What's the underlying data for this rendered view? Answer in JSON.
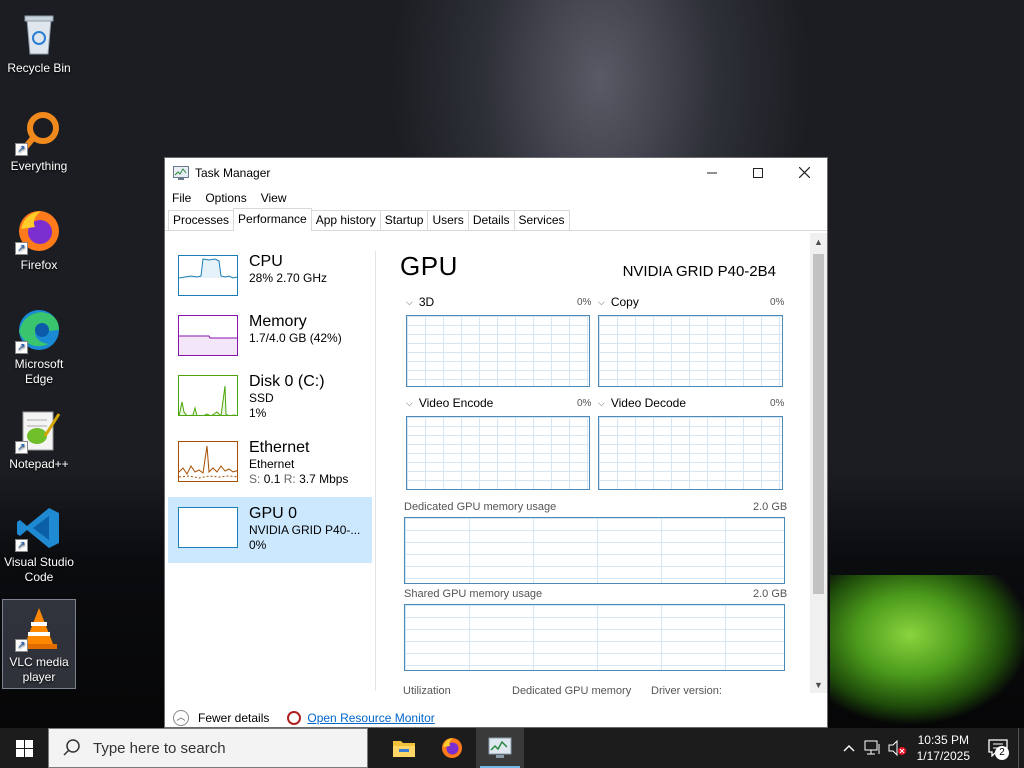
{
  "desktop": {
    "icons": [
      {
        "label": "Recycle Bin",
        "icon": "recycle-bin-icon"
      },
      {
        "label": "Everything",
        "icon": "search-magnifier-icon"
      },
      {
        "label": "Firefox",
        "icon": "firefox-icon"
      },
      {
        "label": "Microsoft Edge",
        "icon": "edge-icon"
      },
      {
        "label": "Notepad++",
        "icon": "notepadpp-icon"
      },
      {
        "label": "Visual Studio Code",
        "icon": "vscode-icon"
      },
      {
        "label": "VLC media player",
        "icon": "vlc-icon"
      }
    ]
  },
  "window": {
    "title": "Task Manager",
    "menu": [
      "File",
      "Options",
      "View"
    ],
    "tabs": [
      "Processes",
      "Performance",
      "App history",
      "Startup",
      "Users",
      "Details",
      "Services"
    ],
    "active_tab": "Performance"
  },
  "sidebar": [
    {
      "name": "CPU",
      "line1": "28%  2.70 GHz",
      "line2": "",
      "color": "#1a7db6",
      "selected": false
    },
    {
      "name": "Memory",
      "line1": "1.7/4.0 GB (42%)",
      "line2": "",
      "color": "#8b12ae",
      "selected": false
    },
    {
      "name": "Disk 0 (C:)",
      "line1": "SSD",
      "line2": "1%",
      "color": "#4da60c",
      "selected": false
    },
    {
      "name": "Ethernet",
      "line1": "Ethernet",
      "line2_s": "S:",
      "line2_s_val": "0.1",
      "line2_r": "R:",
      "line2_r_val": "3.7 Mbps",
      "color": "#a74f01",
      "selected": false
    },
    {
      "name": "GPU 0",
      "line1": "NVIDIA GRID P40-...",
      "line2": "0%",
      "color": "#1a7db6",
      "selected": true
    }
  ],
  "gpu": {
    "title": "GPU",
    "model": "NVIDIA GRID P40-2B4",
    "engines": [
      {
        "name": "3D",
        "pct": "0%"
      },
      {
        "name": "Copy",
        "pct": "0%"
      },
      {
        "name": "Video Encode",
        "pct": "0%"
      },
      {
        "name": "Video Decode",
        "pct": "0%"
      }
    ],
    "dedicated_label": "Dedicated GPU memory usage",
    "dedicated_size": "2.0 GB",
    "shared_label": "Shared GPU memory usage",
    "shared_size": "2.0 GB",
    "stats": [
      "Utilization",
      "Dedicated GPU memory",
      "Driver version:"
    ]
  },
  "footer": {
    "fewer_details": "Fewer details",
    "resource_monitor": "Open Resource Monitor"
  },
  "taskbar": {
    "search_placeholder": "Type here to search",
    "time": "10:35 PM",
    "date": "1/17/2025",
    "notifications": "2"
  }
}
